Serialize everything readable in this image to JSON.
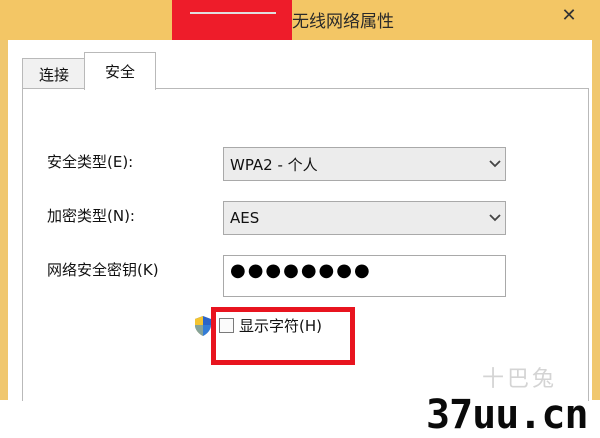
{
  "window": {
    "title": "无线网络属性",
    "close_glyph": "✕"
  },
  "tabs": [
    {
      "label": "连接",
      "active": false
    },
    {
      "label": "安全",
      "active": true
    }
  ],
  "security": {
    "security_type_label": "安全类型(E):",
    "security_type_value": "WPA2 - 个人",
    "encryption_type_label": "加密类型(N):",
    "encryption_type_value": "AES",
    "network_key_label": "网络安全密钥(K)",
    "network_key_value": "●●●●●●●●",
    "show_chars_label": "显示字符(H)",
    "show_chars_checked": false
  },
  "watermark": {
    "brand_cn": "十巴兔",
    "url": "37uu.cn"
  },
  "colors": {
    "titlebar": "#f3c665",
    "redaction": "#ee1c2a",
    "highlight_box": "#e8141f"
  },
  "icons": {
    "dropdown_arrow": "chevron-down-icon",
    "admin_shield": "shield-icon",
    "close": "close-icon"
  }
}
